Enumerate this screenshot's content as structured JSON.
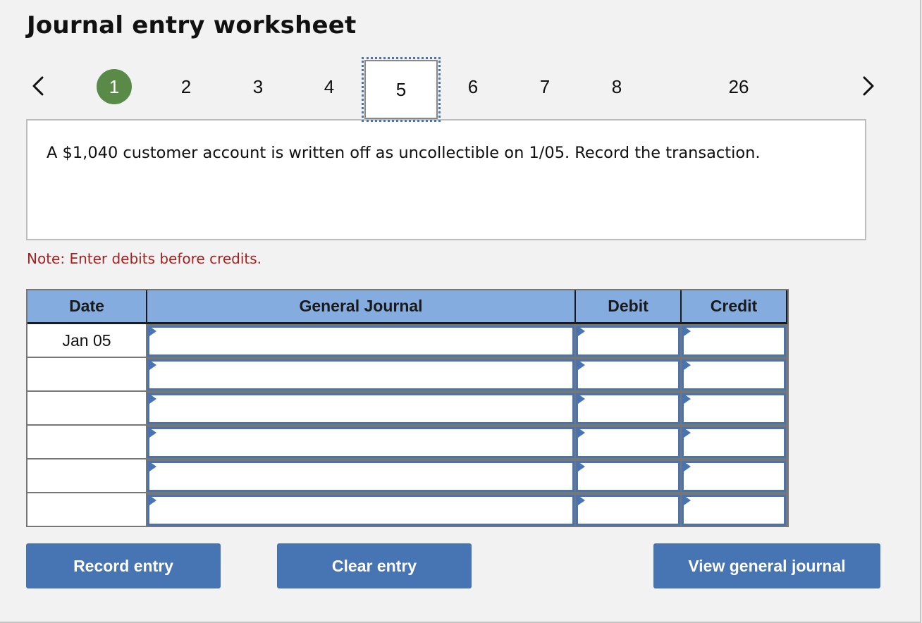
{
  "header": {
    "title": "Journal entry worksheet"
  },
  "pager": {
    "prev_icon": "chevron-left-icon",
    "next_icon": "chevron-right-icon",
    "pages": [
      {
        "label": "1",
        "state": "completed"
      },
      {
        "label": "2",
        "state": "default"
      },
      {
        "label": "3",
        "state": "default"
      },
      {
        "label": "4",
        "state": "default"
      },
      {
        "label": "5",
        "state": "current"
      },
      {
        "label": "6",
        "state": "default"
      },
      {
        "label": "7",
        "state": "default"
      },
      {
        "label": "8",
        "state": "default"
      },
      {
        "label": "26",
        "state": "default"
      }
    ],
    "completed_color": "#5a8a48",
    "focus_color": "#4a74b0"
  },
  "question": {
    "text": "A $1,040 customer account is written off as uncollectible on 1/05. Record the transaction."
  },
  "note": {
    "text": "Note: Enter debits before credits.",
    "color": "#a62020"
  },
  "journal": {
    "headers": {
      "date": "Date",
      "account": "General Journal",
      "debit": "Debit",
      "credit": "Credit"
    },
    "header_color": "#84acdf",
    "rows": [
      {
        "date": "Jan 05",
        "account": "",
        "debit": "",
        "credit": ""
      },
      {
        "date": "",
        "account": "",
        "debit": "",
        "credit": ""
      },
      {
        "date": "",
        "account": "",
        "debit": "",
        "credit": ""
      },
      {
        "date": "",
        "account": "",
        "debit": "",
        "credit": ""
      },
      {
        "date": "",
        "account": "",
        "debit": "",
        "credit": ""
      },
      {
        "date": "",
        "account": "",
        "debit": "",
        "credit": ""
      }
    ]
  },
  "buttons": {
    "record": "Record entry",
    "clear": "Clear entry",
    "view": "View general journal",
    "color": "#4774b3"
  }
}
